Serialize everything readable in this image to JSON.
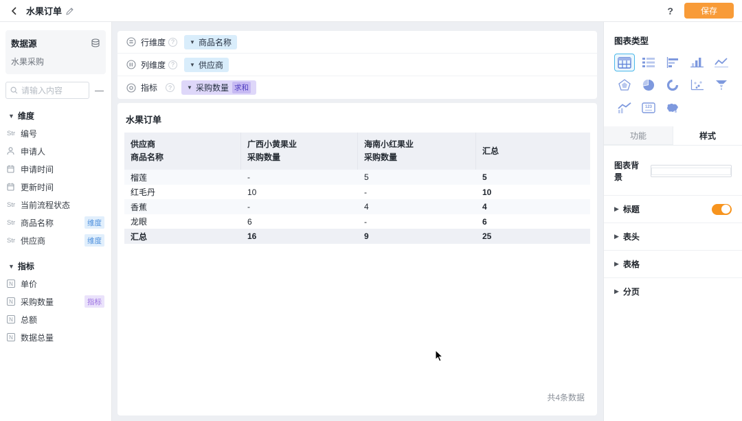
{
  "topbar": {
    "title": "水果订单",
    "help": "?",
    "save": "保存"
  },
  "sidebar": {
    "datasource_label": "数据源",
    "datasource_name": "水果采购",
    "search_placeholder": "请输入内容",
    "collapse": "—",
    "dimensions_header": "维度",
    "metrics_header": "指标",
    "str_icon": "Str",
    "num_icon": "N",
    "dimension_items": [
      {
        "icon": "text-field-icon",
        "label": "编号",
        "badge": ""
      },
      {
        "icon": "person-icon",
        "label": "申请人",
        "badge": ""
      },
      {
        "icon": "calendar-icon",
        "label": "申请时间",
        "badge": ""
      },
      {
        "icon": "calendar-icon",
        "label": "更新时间",
        "badge": ""
      },
      {
        "icon": "text-field-icon",
        "label": "当前流程状态",
        "badge": ""
      },
      {
        "icon": "text-field-icon",
        "label": "商品名称",
        "badge": "维度"
      },
      {
        "icon": "text-field-icon",
        "label": "供应商",
        "badge": "维度"
      }
    ],
    "metric_items": [
      {
        "icon": "number-field-icon",
        "label": "单价",
        "badge": ""
      },
      {
        "icon": "number-field-icon",
        "label": "采购数量",
        "badge": "指标"
      },
      {
        "icon": "number-field-icon",
        "label": "总额",
        "badge": ""
      },
      {
        "icon": "number-field-icon",
        "label": "数据总量",
        "badge": ""
      }
    ]
  },
  "config": {
    "rows": [
      {
        "label": "行维度",
        "chip": "商品名称",
        "agg": ""
      },
      {
        "label": "列维度",
        "chip": "供应商",
        "agg": ""
      },
      {
        "label": "指标",
        "chip": "采购数量",
        "agg": "求和"
      }
    ]
  },
  "pivot": {
    "title": "水果订单",
    "corner_top": "供应商",
    "corner_bottom": "商品名称",
    "col_group_1": "广西小黄果业",
    "col_group_2": "海南小红果业",
    "metric_label": "采购数量",
    "total_label": "汇总",
    "rows": [
      {
        "name": "榴莲",
        "v1": "-",
        "v2": "5",
        "total": "5"
      },
      {
        "name": "红毛丹",
        "v1": "10",
        "v2": "-",
        "total": "10"
      },
      {
        "name": "香蕉",
        "v1": "-",
        "v2": "4",
        "total": "4"
      },
      {
        "name": "龙眼",
        "v1": "6",
        "v2": "-",
        "total": "6"
      }
    ],
    "total_row": {
      "name": "汇总",
      "v1": "16",
      "v2": "9",
      "total": "25"
    },
    "footer": "共4条数据"
  },
  "panel": {
    "chart_type_label": "图表类型",
    "chart_types": [
      "pivot-table",
      "detail-table",
      "bar-horizontal",
      "bar-vertical",
      "line",
      "radar",
      "pie",
      "ring",
      "scatter",
      "funnel",
      "combo",
      "number-card",
      "map"
    ],
    "selected_chart": "pivot-table",
    "tab_function": "功能",
    "tab_style": "样式",
    "active_tab": "样式",
    "background_label": "图表背景",
    "background_value": "#ffffff",
    "section_title": "标题",
    "section_header": "表头",
    "section_table": "表格",
    "section_paging": "分页",
    "title_toggle_on": true
  },
  "colors": {
    "accent_orange": "#f89b38",
    "toggle_orange": "#f7941e",
    "chip_dimension_bg": "#d9edfb",
    "chip_metric_bg": "#ded7f9",
    "agg_badge_bg": "#c7baf3",
    "badge_dimension_bg": "#e1effc",
    "badge_dimension_text": "#4d8fdd",
    "badge_metric_bg": "#eae2fb",
    "badge_metric_text": "#9a6fe0",
    "icon_blue": "#7e99de",
    "selected_chart_border": "#49b7ea",
    "table_header_bg": "#eef0f5"
  }
}
